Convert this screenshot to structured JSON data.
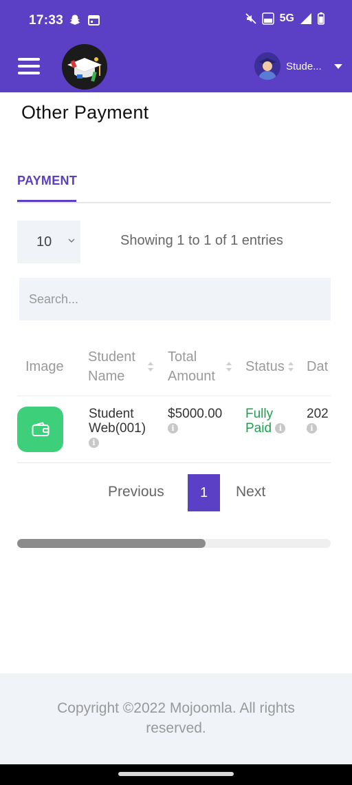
{
  "status_bar": {
    "time": "17:33",
    "network": "5G",
    "icons": [
      "snapchat-icon",
      "calendar-icon",
      "mute-icon",
      "volte-icon",
      "signal-icon",
      "battery-icon"
    ]
  },
  "header": {
    "profile_name": "Stude...",
    "menu_icon": "hamburger-menu-icon"
  },
  "page": {
    "title": "Other Payment"
  },
  "tabs": [
    {
      "label": "PAYMENT",
      "active": true
    }
  ],
  "table_controls": {
    "page_length": "10",
    "info": "Showing 1 to 1 of 1 entries",
    "search_placeholder": "Search..."
  },
  "table": {
    "columns": [
      {
        "label": "Image",
        "sortable": false
      },
      {
        "label": "Student Name",
        "sortable": true
      },
      {
        "label": "Total Amount",
        "sortable": true
      },
      {
        "label": "Status",
        "sortable": true
      },
      {
        "label": "Dat",
        "sortable": true
      }
    ],
    "rows": [
      {
        "image_icon": "wallet-icon",
        "student_name": "Student Web(001)",
        "total_amount": "$5000.00",
        "status": "Fully Paid",
        "date": "202"
      }
    ]
  },
  "pagination": {
    "previous": "Previous",
    "current": "1",
    "next": "Next"
  },
  "scroll": {
    "horizontal_position_fraction": 0.6
  },
  "footer": {
    "text": "Copyright ©2022 Mojoomla. All rights reserved."
  },
  "colors": {
    "primary": "#5b3fc4",
    "success": "#1aa34a",
    "wallet_tile": "#3ecf7a",
    "footer_bg": "#f0f3f8"
  }
}
